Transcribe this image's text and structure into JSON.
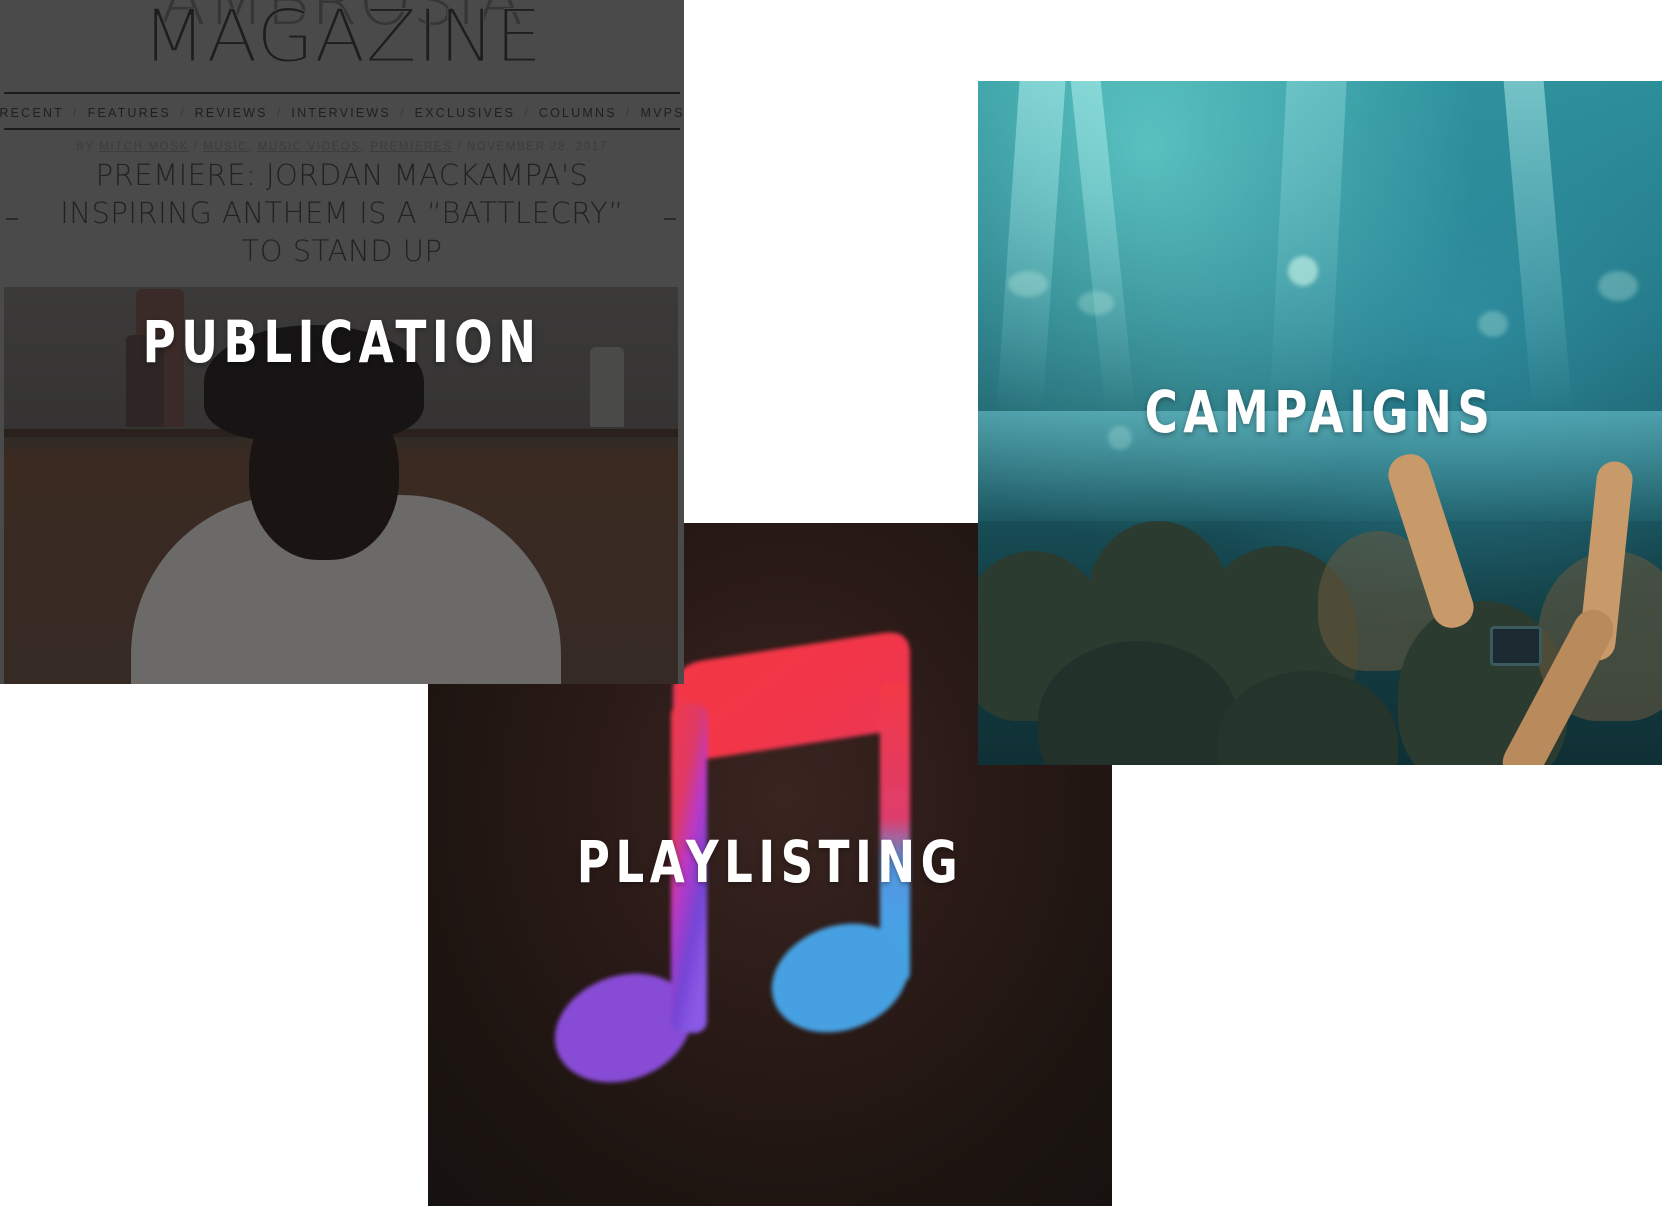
{
  "tiles": {
    "publication": {
      "title": "PUBLICATION",
      "screenshot": {
        "masthead_top": "AMBROSIA",
        "masthead": "MAGAZINE",
        "nav": [
          "RECENT",
          "FEATURES",
          "REVIEWS",
          "INTERVIEWS",
          "EXCLUSIVES",
          "COLUMNS",
          "MVPS"
        ],
        "nav_separator": "/",
        "byline_prefix": "BY",
        "author": "MITCH MOSK",
        "categories": [
          "MUSIC",
          "MUSIC VIDEOS",
          "PREMIERES"
        ],
        "date": "NOVEMBER 28, 2017",
        "headline": "PREMIERE: JORDAN MACKAMPA'S INSPIRING ANTHEM IS A “BATTLECRY” TO STAND UP"
      }
    },
    "playlisting": {
      "title": "PLAYLISTING",
      "icon": "music-note-icon"
    },
    "campaigns": {
      "title": "CAMPAIGNS"
    }
  },
  "colors": {
    "overlay_title": "#ffffff",
    "campaigns_tint": "#1f6e7c",
    "playlisting_bg": "#1c1410",
    "publication_bg": "#4a4a4a"
  }
}
